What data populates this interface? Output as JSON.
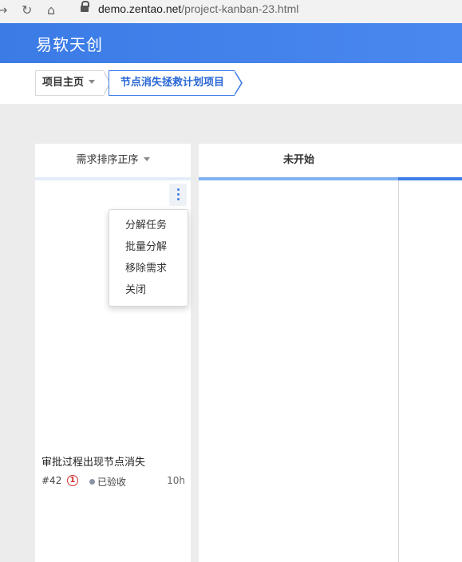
{
  "browser": {
    "url_host": "demo.zentao.net",
    "url_path": "/project-kanban-23.html"
  },
  "header": {
    "brand": "易软天创"
  },
  "breadcrumb": {
    "items": [
      {
        "label": "项目主页"
      },
      {
        "label": "节点消失拯救计划项目"
      }
    ]
  },
  "lane": {
    "title": "需求排序正序",
    "menu": [
      "分解任务",
      "批量分解",
      "移除需求",
      "关闭"
    ],
    "card": {
      "title": "审批过程出现节点消失",
      "id": "#42",
      "priority": "1",
      "stage": "已验收",
      "estimate": "10h"
    }
  },
  "columns": [
    {
      "title": "未开始"
    }
  ],
  "colors": {
    "accent": "#3f7ee8",
    "priority": "#d03030"
  }
}
